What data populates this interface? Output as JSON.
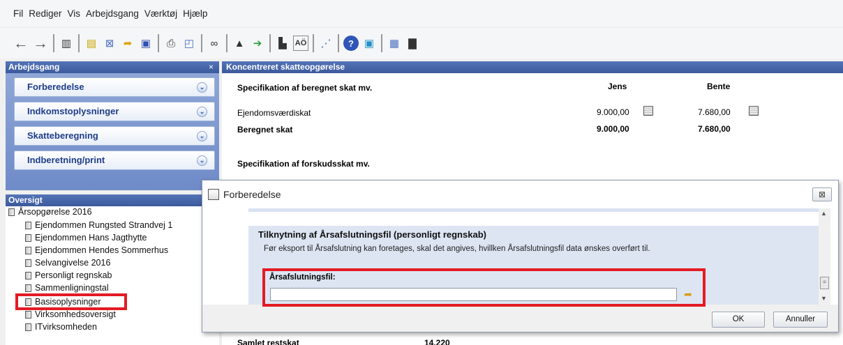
{
  "menu": [
    "Fil",
    "Rediger",
    "Vis",
    "Arbejdsgang",
    "Værktøj",
    "Hjælp"
  ],
  "toolbar_icons": [
    "back-arrow-icon",
    "forward-arrow-icon",
    "book-icon",
    "new-document-icon",
    "close-document-icon",
    "open-folder-icon",
    "save-icon",
    "print-icon",
    "print-preview-icon",
    "link-icon",
    "import-icon",
    "export-icon",
    "archive-icon",
    "text-icon",
    "graph-icon",
    "help-icon",
    "report-icon",
    "calculator-icon",
    "blocks-icon"
  ],
  "workflow": {
    "title": "Arbejdsgang",
    "close": "×",
    "items": [
      {
        "label": "Forberedelse"
      },
      {
        "label": "Indkomstoplysninger"
      },
      {
        "label": "Skatteberegning"
      },
      {
        "label": "Indberetning/print"
      }
    ]
  },
  "overview": {
    "title": "Oversigt",
    "root": "Årsopgørelse 2016",
    "children": [
      "Ejendommen Rungsted Strandvej 1",
      "Ejendommen Hans Jagthytte",
      "Ejendommen Hendes Sommerhus",
      "Selvangivelse 2016",
      "Personligt regnskab",
      "Sammenligningstal",
      "Basisoplysninger",
      "Virksomhedsoversigt",
      "ITvirksomheden"
    ]
  },
  "main": {
    "title": "Koncentreret skatteopgørelse",
    "section1": "Specifikation af beregnet skat mv.",
    "col1": "Jens",
    "col2": "Bente",
    "row1_label": "Ejendomsværdiskat",
    "row1_v1": "9.000,00",
    "row1_v2": "7.680,00",
    "row2_label": "Beregnet skat",
    "row2_v1": "9.000,00",
    "row2_v2": "7.680,00",
    "section2": "Specifikation af forskudsskat mv.",
    "bottom_label": "Samlet restskat",
    "bottom_value": "14.220"
  },
  "dialog": {
    "title": "Forberedelse",
    "close": "⊠",
    "section_title": "Tilknytning af Årsafslutningsfil (personligt regnskab)",
    "description": "Før eksport til Årsafslutning kan foretages, skal  det angives, hvillken Årsafslutningsfil  data ønskes overført til.",
    "field_label": "Årsafslutningsfil:",
    "field_value": "",
    "ok": "OK",
    "cancel": "Annuller"
  },
  "colors": {
    "header_blue": "#3c5a9c",
    "workflow_text": "#1e3c8a",
    "highlight_red": "#e31b23"
  }
}
